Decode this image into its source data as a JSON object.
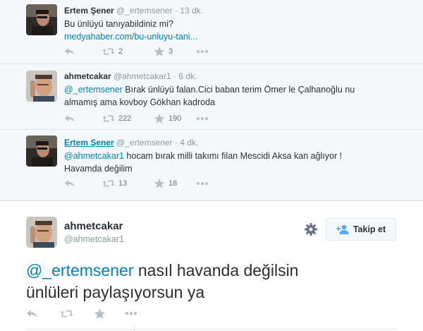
{
  "thread": [
    {
      "name": "Ertem Şener",
      "handle": "@_ertemsener",
      "time": "· 13 dk.",
      "line1": "Bu ünlüyü tanıyabildiniz mi?",
      "link": "medyahaber.com/bu-unluyu-tani...",
      "retweets": "2",
      "favorites": "3"
    },
    {
      "name": "ahmetcakar",
      "handle": "@ahmetcakar1",
      "time": "· 6 dk.",
      "mention": "@_ertemsener",
      "line1_rest": " Bırak ünlüyü falan.Cici baban terim Ömer le Çalhanoğlu nu",
      "line2": "almamış ama kovboy Gökhan kadroda",
      "retweets": "222",
      "favorites": "190"
    },
    {
      "name": "Ertem Şener",
      "handle": "@_ertemsener",
      "time": "· 4 dk.",
      "mention": "@ahmetcakar1",
      "line1_rest": " hocam bırak milli takımı filan Mescidi Aksa kan ağlıyor !",
      "line2": "Havamda değilim",
      "retweets": "13",
      "favorites": "18"
    }
  ],
  "main": {
    "name": "ahmetcakar",
    "handle": "@ahmetcakar1",
    "follow_label": "Takip et",
    "mention": "@_ertemsener",
    "text_rest": " nasıl havanda değilsin",
    "text_line2": "ünlüleri paylaşıyorsun ya"
  },
  "icons": {
    "reply": "reply-icon",
    "retweet": "retweet-icon",
    "favorite": "star-icon",
    "more": "more-icon",
    "gear": "gear-icon",
    "follow": "add-person-icon"
  },
  "colors": {
    "link": "#0084b4",
    "muted": "#8899a6",
    "thread_bg": "#f5f8fa"
  }
}
